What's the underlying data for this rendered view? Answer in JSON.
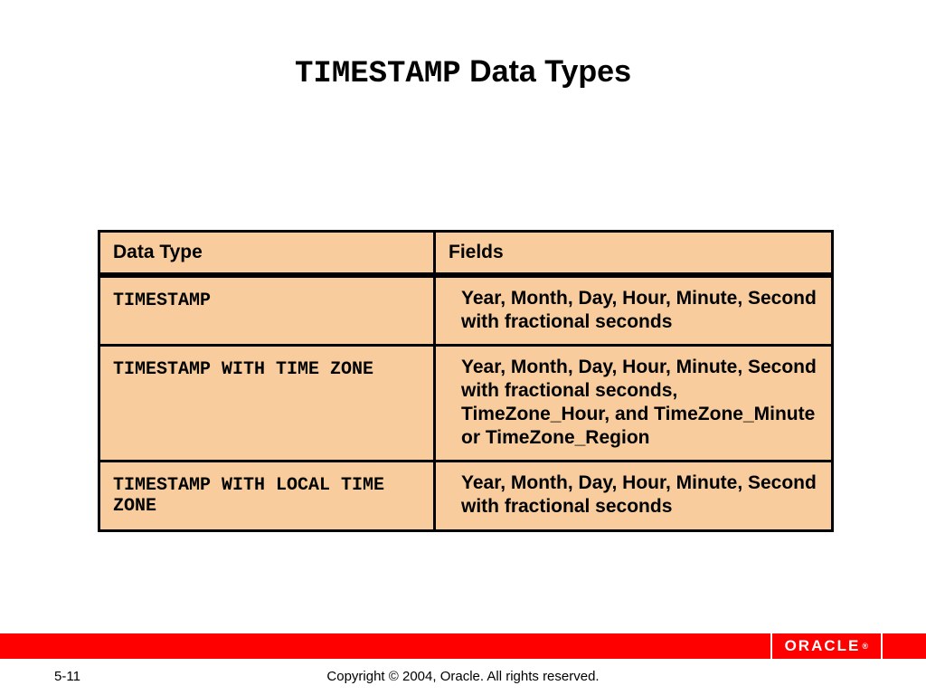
{
  "title": {
    "keyword": "TIMESTAMP",
    "rest": " Data Types"
  },
  "table": {
    "headers": {
      "col1": "Data Type",
      "col2": "Fields"
    },
    "rows": [
      {
        "type": "TIMESTAMP",
        "fields": "Year, Month, Day, Hour, Minute, Second with fractional seconds"
      },
      {
        "type": "TIMESTAMP WITH TIME ZONE",
        "fields": "Year, Month, Day, Hour, Minute, Second with fractional seconds, TimeZone_Hour, and TimeZone_Minute or TimeZone_Region"
      },
      {
        "type": "TIMESTAMP WITH LOCAL TIME ZONE",
        "fields": "Year, Month, Day, Hour, Minute, Second with fractional seconds"
      }
    ]
  },
  "footer": {
    "page": "5-11",
    "copyright": "Copyright © 2004, Oracle.  All rights reserved.",
    "logo": "ORACLE"
  }
}
